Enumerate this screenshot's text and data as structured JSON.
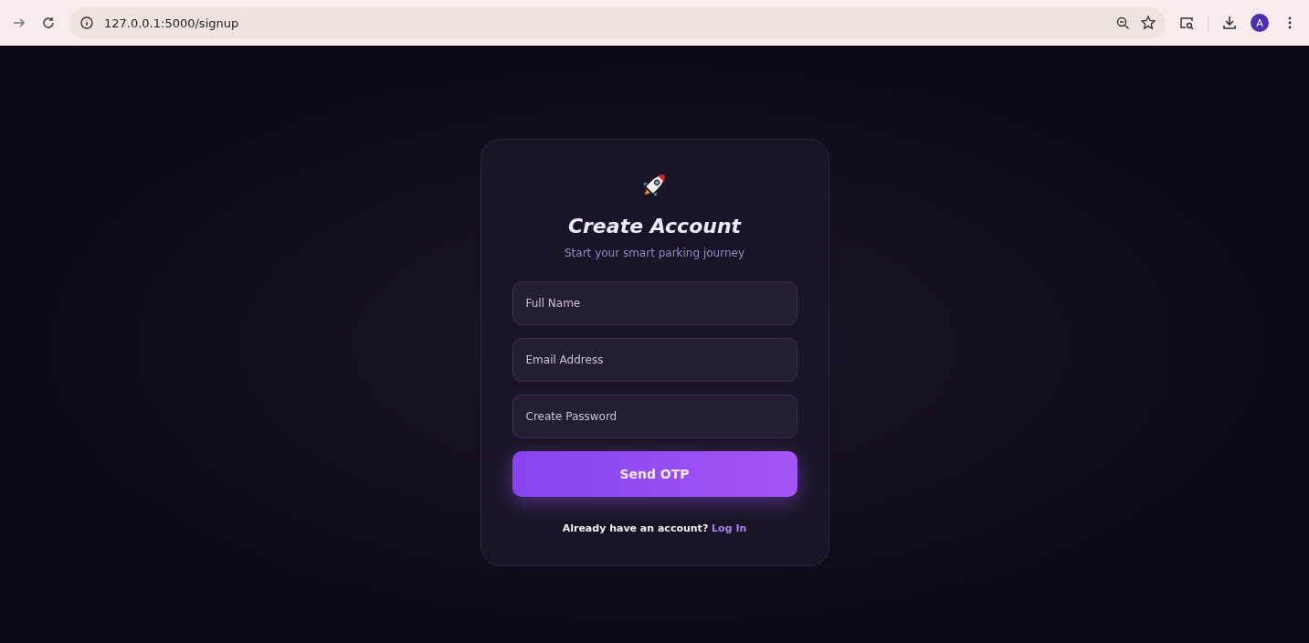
{
  "browser": {
    "url": "127.0.0.1:5000/signup",
    "profile_initial": "A"
  },
  "card": {
    "title": "Create Account",
    "subtitle": "Start your smart parking journey",
    "fields": [
      {
        "placeholder": "Full Name"
      },
      {
        "placeholder": "Email Address"
      },
      {
        "placeholder": "Create Password"
      }
    ],
    "submit": "Send OTP",
    "footer_text": "Already have an account?",
    "footer_link": "Log In"
  }
}
